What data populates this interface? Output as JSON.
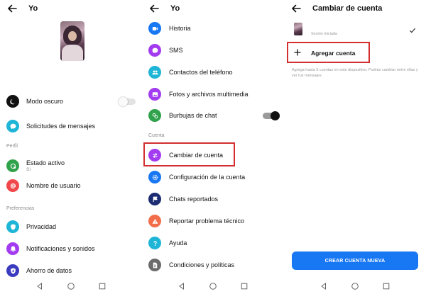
{
  "panel1": {
    "title": "Yo",
    "items": [
      {
        "label": "Modo oscuro",
        "icon": "moon-icon",
        "color": "#111111"
      },
      {
        "label": "Solicitudes de mensajes",
        "icon": "chat-bubble-icon",
        "color": "#1fb5d6"
      }
    ],
    "section_profile": "Perfil",
    "profile_items": [
      {
        "label": "Estado activo",
        "sub": "Sí",
        "icon": "active-status-icon",
        "color": "#31a24c"
      },
      {
        "label": "Nombre de usuario",
        "icon": "at-sign-icon",
        "color": "#f0484a"
      }
    ],
    "section_prefs": "Preferencias",
    "pref_items": [
      {
        "label": "Privacidad",
        "icon": "shield-icon",
        "color": "#1fb5d6"
      },
      {
        "label": "Notificaciones y sonidos",
        "icon": "bell-icon",
        "color": "#a33cf0"
      },
      {
        "label": "Ahorro de datos",
        "icon": "data-shield-icon",
        "color": "#3b3bbf"
      }
    ]
  },
  "panel2": {
    "title": "Yo",
    "items": [
      {
        "label": "Historia",
        "icon": "story-icon",
        "color": "#1877f2"
      },
      {
        "label": "SMS",
        "icon": "sms-icon",
        "color": "#a33cf0"
      },
      {
        "label": "Contactos del teléfono",
        "icon": "contacts-icon",
        "color": "#1fb5d6"
      },
      {
        "label": "Fotos y archivos multimedia",
        "icon": "photo-icon",
        "color": "#a33cf0"
      },
      {
        "label": "Burbujas de chat",
        "icon": "chat-heads-icon",
        "color": "#31a24c"
      }
    ],
    "section_account": "Cuenta",
    "account_items": [
      {
        "label": "Cambiar de cuenta",
        "icon": "switch-account-icon",
        "color": "#a33cf0"
      },
      {
        "label": "Configuración de la cuenta",
        "icon": "gear-icon",
        "color": "#1877f2"
      },
      {
        "label": "Chats reportados",
        "icon": "flag-icon",
        "color": "#1b2c73"
      },
      {
        "label": "Reportar problema técnico",
        "icon": "warning-icon",
        "color": "#f26d4a"
      },
      {
        "label": "Ayuda",
        "icon": "help-icon",
        "color": "#1fb5d6"
      },
      {
        "label": "Condiciones y políticas",
        "icon": "document-icon",
        "color": "#6b6b6b"
      }
    ]
  },
  "panel3": {
    "title": "Cambiar de cuenta",
    "account_status": "Sesión iniciada",
    "add_account_label": "Agregar cuenta",
    "help_text": "Agrega hasta 5 cuentas en este dispositivo. Podrás cambiar entre ellas y ver tus mensajes.",
    "create_button": "CREAR CUENTA NUEVA",
    "accent": "#1877f2"
  },
  "highlight_color": "#d32f2f"
}
